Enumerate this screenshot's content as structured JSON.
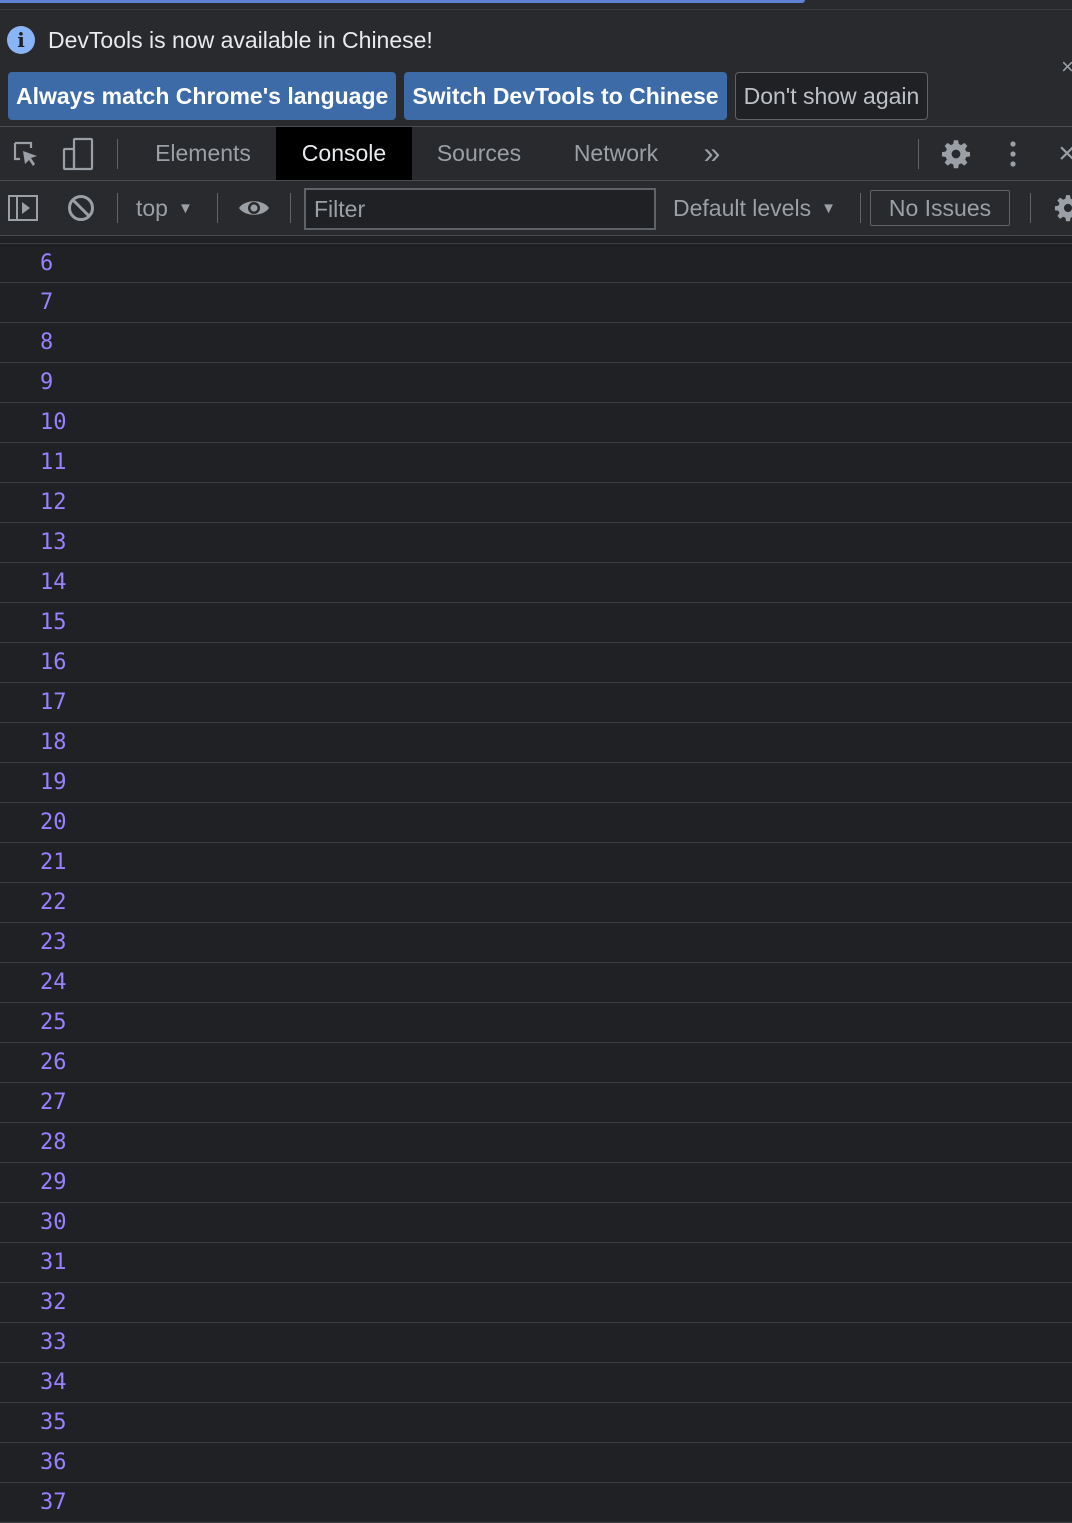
{
  "infobar": {
    "message": "DevTools is now available in Chinese!",
    "info_icon_glyph": "i",
    "close_glyph": "×",
    "buttons": [
      {
        "label": "Always match Chrome's language"
      },
      {
        "label": "Switch DevTools to Chinese"
      },
      {
        "label": "Don't show again"
      }
    ]
  },
  "tabs": {
    "items": [
      {
        "label": "Elements"
      },
      {
        "label": "Console"
      },
      {
        "label": "Sources"
      },
      {
        "label": "Network"
      }
    ],
    "active": "Console",
    "overflow_glyph": "»",
    "close_glyph": "×"
  },
  "toolbar": {
    "context": "top",
    "filter_placeholder": "Filter",
    "levels": "Default levels",
    "issues": "No Issues"
  },
  "console": {
    "rows": [
      "6",
      "7",
      "8",
      "9",
      "10",
      "11",
      "12",
      "13",
      "14",
      "15",
      "16",
      "17",
      "18",
      "19",
      "20",
      "21",
      "22",
      "23",
      "24",
      "25",
      "26",
      "27",
      "28",
      "29",
      "30",
      "31",
      "32",
      "33",
      "34",
      "35",
      "36",
      "37"
    ]
  },
  "colors": {
    "background": "#202124",
    "toolbar": "#292a2d",
    "primary_button": "#3d6ba8",
    "accent_blue": "#8ab4f8",
    "number_purple": "#9980ff"
  }
}
